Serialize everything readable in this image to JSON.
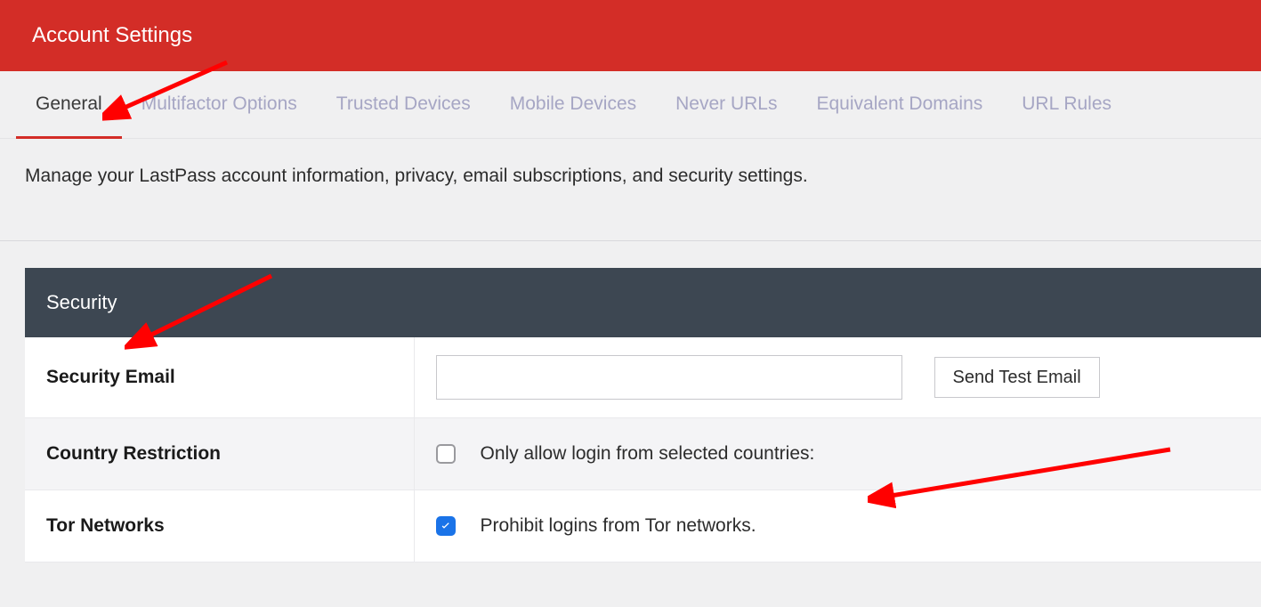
{
  "header": {
    "title": "Account Settings"
  },
  "tabs": [
    {
      "label": "General",
      "active": true
    },
    {
      "label": "Multifactor Options",
      "active": false
    },
    {
      "label": "Trusted Devices",
      "active": false
    },
    {
      "label": "Mobile Devices",
      "active": false
    },
    {
      "label": "Never URLs",
      "active": false
    },
    {
      "label": "Equivalent Domains",
      "active": false
    },
    {
      "label": "URL Rules",
      "active": false
    }
  ],
  "description": "Manage your LastPass account information, privacy, email subscriptions, and security settings.",
  "section": {
    "title": "Security"
  },
  "settings": {
    "security_email": {
      "label": "Security Email",
      "value": "",
      "button": "Send Test Email"
    },
    "country_restriction": {
      "label": "Country Restriction",
      "checkbox_label": "Only allow login from selected countries:",
      "checked": false
    },
    "tor_networks": {
      "label": "Tor Networks",
      "checkbox_label": "Prohibit logins from Tor networks.",
      "checked": true
    }
  }
}
